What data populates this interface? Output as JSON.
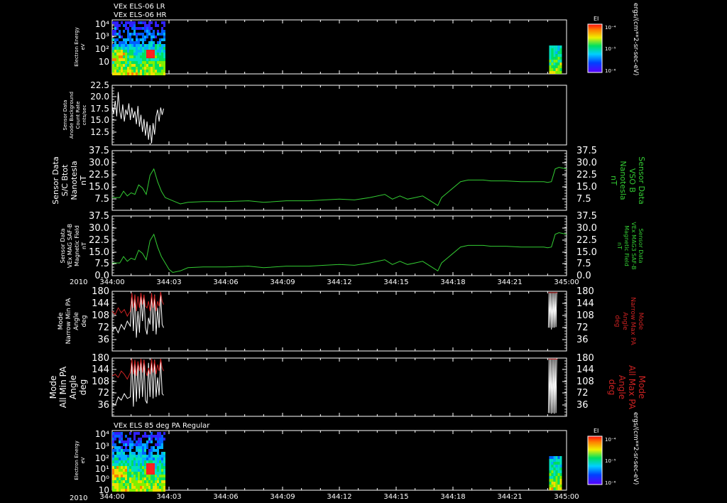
{
  "colors": {
    "background": "#000000",
    "axis": "#ffffff",
    "green_trace": "#33cc33",
    "red_trace": "#cc2222",
    "white_trace": "#ffffff"
  },
  "chart_data": [
    {
      "type": "heatmap",
      "panel": "electron-energy-1",
      "title_lines": [
        "VEx ELS-06 LR",
        "VEx ELS-06 HR"
      ],
      "ylabel_lines": [
        "Electron Energy",
        "eV"
      ],
      "y_scale": "log",
      "y_ticks": [
        "10⁴",
        "10³",
        "10²",
        "10"
      ],
      "colorbar": {
        "title": "EI",
        "ticks": [
          "10⁻⁴",
          "10⁻⁵",
          "10⁻⁶"
        ],
        "unit": "ergs/(cm**2-sr-sec-eV)"
      },
      "data_extent_hours": [
        [
          0,
          0.68
        ],
        [
          5.77,
          5.92
        ]
      ]
    },
    {
      "type": "line",
      "panel": "anode-background",
      "ylabel_lines": [
        "Sensor Data",
        "Anode Background",
        "Count Rate",
        "cnts/sec"
      ],
      "y_ticks": [
        "22.5",
        "20.0",
        "17.5",
        "15.0",
        "12.5"
      ],
      "ylim": [
        11,
        22.5
      ],
      "series": [
        {
          "color": "white",
          "x": [
            0.0,
            0.02,
            0.04,
            0.06,
            0.08,
            0.1,
            0.12,
            0.14,
            0.16,
            0.18,
            0.2,
            0.22,
            0.24,
            0.26,
            0.28,
            0.3,
            0.32,
            0.34,
            0.36,
            0.38,
            0.4,
            0.42,
            0.44,
            0.46,
            0.48,
            0.5,
            0.52,
            0.54,
            0.56,
            0.58,
            0.6,
            0.62,
            0.64,
            0.66,
            0.68
          ],
          "y": [
            18.5,
            17.0,
            19.5,
            16.5,
            21.2,
            17.5,
            16.0,
            18.8,
            15.5,
            17.8,
            16.8,
            19.0,
            15.8,
            18.2,
            16.2,
            17.5,
            15.0,
            18.5,
            14.5,
            16.8,
            13.5,
            16.0,
            12.8,
            15.5,
            12.0,
            14.8,
            11.3,
            15.2,
            13.0,
            16.5,
            17.8,
            15.5,
            18.2,
            16.8,
            18.0
          ]
        }
      ]
    },
    {
      "type": "line",
      "panel": "sc-btot",
      "ylabel_lines": [
        "Sensor Data",
        "S/C Btot",
        "Nanotesla",
        "nT"
      ],
      "right_label_lines": [
        "Sensor Data",
        "VSO B",
        "Nanotesla",
        "nT"
      ],
      "y_ticks": [
        "37.5",
        "30.0",
        "22.5",
        "15.0",
        "7.5"
      ],
      "ylim": [
        0,
        37.5
      ],
      "series": [
        {
          "name": "VSO B",
          "color": "green",
          "x": [
            0.0,
            0.1,
            0.15,
            0.2,
            0.25,
            0.3,
            0.35,
            0.4,
            0.45,
            0.5,
            0.55,
            0.6,
            0.65,
            0.7,
            0.75,
            0.8,
            0.9,
            1.0,
            1.2,
            1.5,
            1.8,
            2.0,
            2.3,
            2.6,
            2.8,
            3.0,
            3.2,
            3.4,
            3.6,
            3.7,
            3.8,
            3.9,
            4.0,
            4.1,
            4.2,
            4.3,
            4.35,
            4.45,
            4.6,
            4.7,
            4.8,
            4.9,
            5.0,
            5.2,
            5.4,
            5.6,
            5.7,
            5.75,
            5.8,
            5.85,
            5.9,
            6.0
          ],
          "y": [
            8,
            8,
            12,
            9,
            11,
            10,
            16,
            14,
            10,
            22,
            26,
            18,
            12,
            8,
            7,
            6,
            4,
            5,
            5.5,
            5.5,
            6,
            5,
            6,
            6,
            6.5,
            7,
            6.5,
            8,
            10,
            7,
            9,
            7,
            8,
            9,
            6,
            3,
            8,
            12,
            18,
            19,
            19,
            19,
            18.5,
            18.5,
            18,
            18,
            18,
            17.5,
            18,
            26,
            27,
            26
          ]
        }
      ]
    },
    {
      "type": "line",
      "panel": "mag-field",
      "ylabel_lines": [
        "Sensor Data",
        "VEx MAG SAF-B",
        "Magnetic Field",
        "nT"
      ],
      "right_label_lines": [
        "Sensor Data",
        "VEx MAG3 SAF-B",
        "Magnetic Field",
        "nT"
      ],
      "y_ticks": [
        "37.5",
        "30.0",
        "22.5",
        "15.0",
        "7.5",
        "0.0"
      ],
      "ylim": [
        0,
        37.5
      ],
      "series": [
        {
          "name": "VEx MAG3 SAF-B",
          "color": "green",
          "x": [
            0.0,
            0.1,
            0.15,
            0.2,
            0.25,
            0.3,
            0.35,
            0.4,
            0.45,
            0.5,
            0.55,
            0.6,
            0.65,
            0.7,
            0.75,
            0.8,
            0.9,
            1.0,
            1.2,
            1.5,
            1.8,
            2.0,
            2.3,
            2.6,
            2.8,
            3.0,
            3.2,
            3.4,
            3.6,
            3.7,
            3.8,
            3.9,
            4.0,
            4.1,
            4.2,
            4.3,
            4.35,
            4.45,
            4.6,
            4.7,
            4.8,
            4.9,
            5.0,
            5.2,
            5.4,
            5.6,
            5.7,
            5.75,
            5.8,
            5.85,
            5.9,
            6.0
          ],
          "y": [
            8,
            8,
            12,
            9,
            11,
            10,
            16,
            14,
            10,
            22,
            26,
            18,
            12,
            8,
            4,
            2,
            3,
            5,
            5.5,
            5.5,
            6,
            5,
            6,
            6,
            6.5,
            7,
            6.5,
            8,
            10,
            7,
            9,
            7,
            8,
            9,
            6,
            3,
            8,
            12,
            18,
            19,
            19,
            19,
            18.5,
            18.5,
            18,
            18,
            18,
            17.5,
            18,
            26,
            27,
            26
          ]
        }
      ]
    },
    {
      "type": "line",
      "panel": "narrow-pa",
      "ylabel_lines": [
        "Mode",
        "Narrow Min PA",
        "Angle",
        "deg"
      ],
      "right_label_lines": [
        "Mode",
        "Narrow Max PA",
        "Angle",
        "deg"
      ],
      "y_ticks": [
        "180",
        "144",
        "108",
        "72",
        "36"
      ],
      "ylim": [
        0,
        180
      ],
      "series": [
        {
          "name": "Narrow Min PA",
          "color": "white",
          "x": [
            0.0,
            0.04,
            0.08,
            0.12,
            0.16,
            0.2,
            0.24,
            0.26,
            0.28,
            0.3,
            0.32,
            0.34,
            0.36,
            0.38,
            0.4,
            0.42,
            0.44,
            0.46,
            0.48,
            0.5,
            0.52,
            0.54,
            0.56,
            0.58,
            0.6,
            0.62,
            0.64,
            0.66,
            0.68
          ],
          "y": [
            60,
            72,
            55,
            80,
            65,
            90,
            75,
            170,
            60,
            170,
            40,
            120,
            55,
            170,
            90,
            165,
            70,
            50,
            100,
            80,
            170,
            60,
            170,
            50,
            130,
            70,
            175,
            80,
            70
          ]
        },
        {
          "name": "Narrow Max PA",
          "color": "red",
          "x": [
            0.0,
            0.04,
            0.08,
            0.12,
            0.16,
            0.2,
            0.24,
            0.26,
            0.28,
            0.3,
            0.32,
            0.34,
            0.36,
            0.38,
            0.4,
            0.42,
            0.44,
            0.46,
            0.48,
            0.5,
            0.52,
            0.54,
            0.56,
            0.58,
            0.6,
            0.62,
            0.64,
            0.66,
            0.68
          ],
          "y": [
            120,
            110,
            130,
            115,
            125,
            105,
            120,
            175,
            130,
            170,
            120,
            165,
            130,
            175,
            140,
            170,
            135,
            130,
            150,
            120,
            175,
            130,
            170,
            120,
            150,
            135,
            178,
            150,
            140
          ]
        },
        {
          "name": "Narrow Min PA late",
          "color": "white",
          "x": [
            5.76,
            5.77,
            5.78,
            5.79,
            5.8,
            5.81,
            5.82,
            5.83,
            5.84,
            5.85,
            5.86,
            5.87,
            5.88
          ],
          "y": [
            70,
            175,
            70,
            175,
            65,
            175,
            70,
            175,
            70,
            175,
            72,
            175,
            175
          ]
        },
        {
          "name": "Narrow Max PA late",
          "color": "red",
          "x": [
            5.76,
            5.88
          ],
          "y": [
            176,
            176
          ]
        }
      ]
    },
    {
      "type": "line",
      "panel": "all-pa",
      "ylabel_lines": [
        "Mode",
        "All Min PA",
        "Angle",
        "deg"
      ],
      "right_label_lines": [
        "Mode",
        "All Max PA",
        "Angle",
        "deg"
      ],
      "y_ticks": [
        "180",
        "144",
        "108",
        "72",
        "36"
      ],
      "ylim": [
        0,
        180
      ],
      "series": [
        {
          "name": "All Min PA",
          "color": "white",
          "x": [
            0.0,
            0.04,
            0.08,
            0.12,
            0.16,
            0.2,
            0.24,
            0.26,
            0.28,
            0.3,
            0.32,
            0.34,
            0.36,
            0.38,
            0.4,
            0.42,
            0.44,
            0.46,
            0.48,
            0.5,
            0.52,
            0.54,
            0.56,
            0.58,
            0.6,
            0.62,
            0.64,
            0.66,
            0.68
          ],
          "y": [
            40,
            35,
            60,
            50,
            70,
            55,
            60,
            170,
            30,
            170,
            45,
            165,
            55,
            170,
            60,
            175,
            50,
            40,
            165,
            60,
            170,
            55,
            175,
            60,
            120,
            65,
            175,
            70,
            65
          ]
        },
        {
          "name": "All Max PA",
          "color": "red",
          "x": [
            0.0,
            0.04,
            0.08,
            0.12,
            0.16,
            0.2,
            0.24,
            0.26,
            0.28,
            0.3,
            0.32,
            0.34,
            0.36,
            0.38,
            0.4,
            0.42,
            0.44,
            0.46,
            0.48,
            0.5,
            0.52,
            0.54,
            0.56,
            0.58,
            0.6,
            0.62,
            0.64,
            0.66,
            0.68
          ],
          "y": [
            125,
            130,
            120,
            140,
            130,
            115,
            135,
            178,
            130,
            175,
            125,
            170,
            140,
            178,
            135,
            175,
            140,
            125,
            150,
            130,
            178,
            135,
            175,
            130,
            160,
            140,
            178,
            150,
            140
          ]
        },
        {
          "name": "All Min PA late",
          "color": "white",
          "x": [
            5.76,
            5.77,
            5.78,
            5.79,
            5.8,
            5.81,
            5.82,
            5.83,
            5.84,
            5.85,
            5.86,
            5.87,
            5.88
          ],
          "y": [
            10,
            178,
            10,
            178,
            8,
            178,
            10,
            178,
            8,
            178,
            10,
            178,
            178
          ]
        },
        {
          "name": "All Max PA late",
          "color": "red",
          "x": [
            5.76,
            5.88
          ],
          "y": [
            177,
            177
          ]
        }
      ]
    },
    {
      "type": "heatmap",
      "panel": "electron-energy-2",
      "title_lines": [
        "VEx ELS 85 deg PA Regular"
      ],
      "ylabel_lines": [
        "Electron Energy",
        "eV"
      ],
      "y_scale": "log",
      "y_ticks": [
        "10⁴",
        "10³",
        "10²",
        "10¹",
        "10⁰",
        "10"
      ],
      "colorbar": {
        "title": "EI",
        "ticks": [
          "10⁻⁴",
          "10⁻⁵",
          "10⁻⁶"
        ],
        "unit": "ergs/(cm**2-sr-sec-eV)"
      },
      "data_extent_hours": [
        [
          0,
          0.68
        ],
        [
          5.77,
          5.92
        ]
      ]
    }
  ],
  "x_axis": {
    "year_label": "2010",
    "tick_labels": [
      "344:00",
      "344:03",
      "344:06",
      "344:09",
      "344:12",
      "344:15",
      "344:18",
      "344:21",
      "345:00"
    ],
    "xlim_hours": [
      0,
      6
    ]
  },
  "labels": {
    "title_1a": "VEx ELS-06 LR",
    "title_1b": "VEx ELS-06 HR",
    "title_7": "VEx ELS 85 deg PA Regular",
    "year_1": "2010",
    "year_2": "2010",
    "cb_title_1": "EI",
    "cb_title_2": "EI",
    "cb_unit_1": "ergs/(cm**2-sr-sec-eV)",
    "cb_unit_2": "ergs/(cm**2-sr-sec-eV)"
  }
}
